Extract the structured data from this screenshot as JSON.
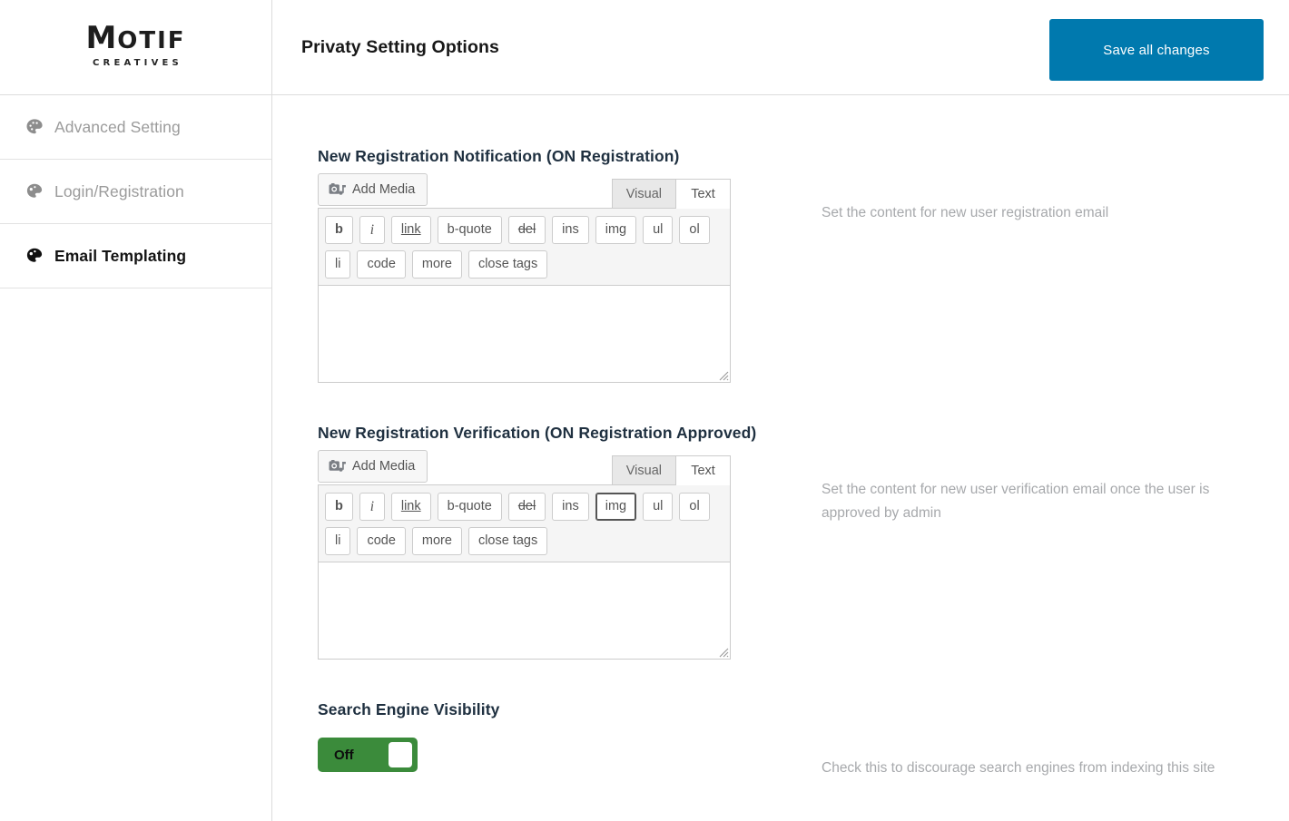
{
  "brand": {
    "name_cap": "M",
    "name_rest": "OTIF",
    "tagline": "CREATIVES"
  },
  "sidebar": {
    "items": [
      {
        "label": "Advanced Setting",
        "icon": "palette-icon",
        "active": false
      },
      {
        "label": "Login/Registration",
        "icon": "palette-icon",
        "active": false
      },
      {
        "label": "Email Templating",
        "icon": "palette-icon",
        "active": true
      }
    ]
  },
  "topbar": {
    "title": "Privaty Setting Options",
    "save_label": "Save all changes",
    "save_color": "#0079ae"
  },
  "editor_common": {
    "add_media_label": "Add Media",
    "tab_visual": "Visual",
    "tab_text": "Text",
    "quicktags": [
      {
        "label": "b",
        "style": "b"
      },
      {
        "label": "i",
        "style": "i"
      },
      {
        "label": "link",
        "style": "u"
      },
      {
        "label": "b-quote",
        "style": ""
      },
      {
        "label": "del",
        "style": "s"
      },
      {
        "label": "ins",
        "style": ""
      },
      {
        "label": "img",
        "style": ""
      },
      {
        "label": "ul",
        "style": ""
      },
      {
        "label": "ol",
        "style": ""
      },
      {
        "label": "li",
        "style": ""
      },
      {
        "label": "code",
        "style": ""
      },
      {
        "label": "more",
        "style": ""
      },
      {
        "label": "close tags",
        "style": ""
      }
    ]
  },
  "sections": [
    {
      "title": "New Registration Notification (ON Registration)",
      "description": "Set the content for new user registration email",
      "editor_value": "",
      "focused_quicktag": null
    },
    {
      "title": "New Registration Verification (ON Registration Approved)",
      "description": "Set the content for new user verification email once the user is approved by admin",
      "editor_value": "",
      "focused_quicktag": "img"
    }
  ],
  "search_engine_visibility": {
    "title": "Search Engine Visibility",
    "description": "Check this to discourage search engines from indexing this site",
    "toggle_state": "Off",
    "toggle_color": "#3b8b3b"
  }
}
